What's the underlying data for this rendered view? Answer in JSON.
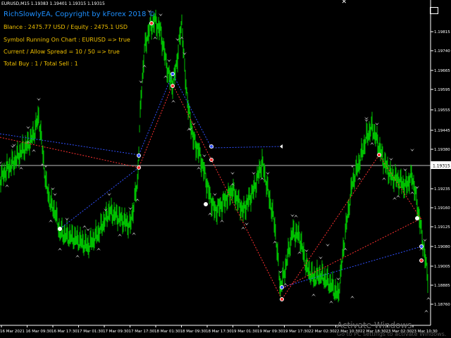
{
  "window": {
    "symbol_line": "EURUSD,M15  1.19383 1.19401 1.19315 1.19315"
  },
  "overlay": {
    "title": "RichSlowlyEA, Copyright by kForex 2018 ©",
    "lines": [
      "Blance : 2475.77 USD /  Equity : 2475.1 USD",
      "Symbol Running On Chart : EURUSD => true",
      "Current / Allow Spread = 10 / 50 => true",
      "Total Buy : 1 / Total Sell : 1"
    ]
  },
  "price_axis": {
    "ticks": [
      "1.19815",
      "1.19665",
      "1.19555",
      "1.19445",
      "1.19380",
      "1.19235",
      "1.19125",
      "1.19080",
      "1.19005",
      "1.18885",
      "1.18760"
    ],
    "current_price_label": "1.19315"
  },
  "time_axis": {
    "ticks": [
      "16 Mar 2021",
      "16 Mar 09:30",
      "16 Mar 17:30",
      "17 Mar 01:30",
      "17 Mar 09:30",
      "17 Mar 17:30",
      "18 Mar 01:30",
      "18 Mar 09:30",
      "18 Mar 17:30",
      "19 Mar 01:30",
      "19 Mar 09:30",
      "19 Mar 17:30",
      "22 Mar 02:30",
      "22 Mar 10:30",
      "22 Mar 18:30",
      "23 Mar 02:30",
      "23 Mar 10:30"
    ]
  },
  "watermark": {
    "line1": "Activate Windows",
    "line2": "Go to PC settings to activate Windows."
  },
  "colors": {
    "background": "#000000",
    "candles": "#00c000",
    "text": "#ffffff",
    "info": "#f0c000",
    "title": "#1e90ff",
    "buy_line": "#3050ff",
    "sell_line": "#ff3030"
  }
}
